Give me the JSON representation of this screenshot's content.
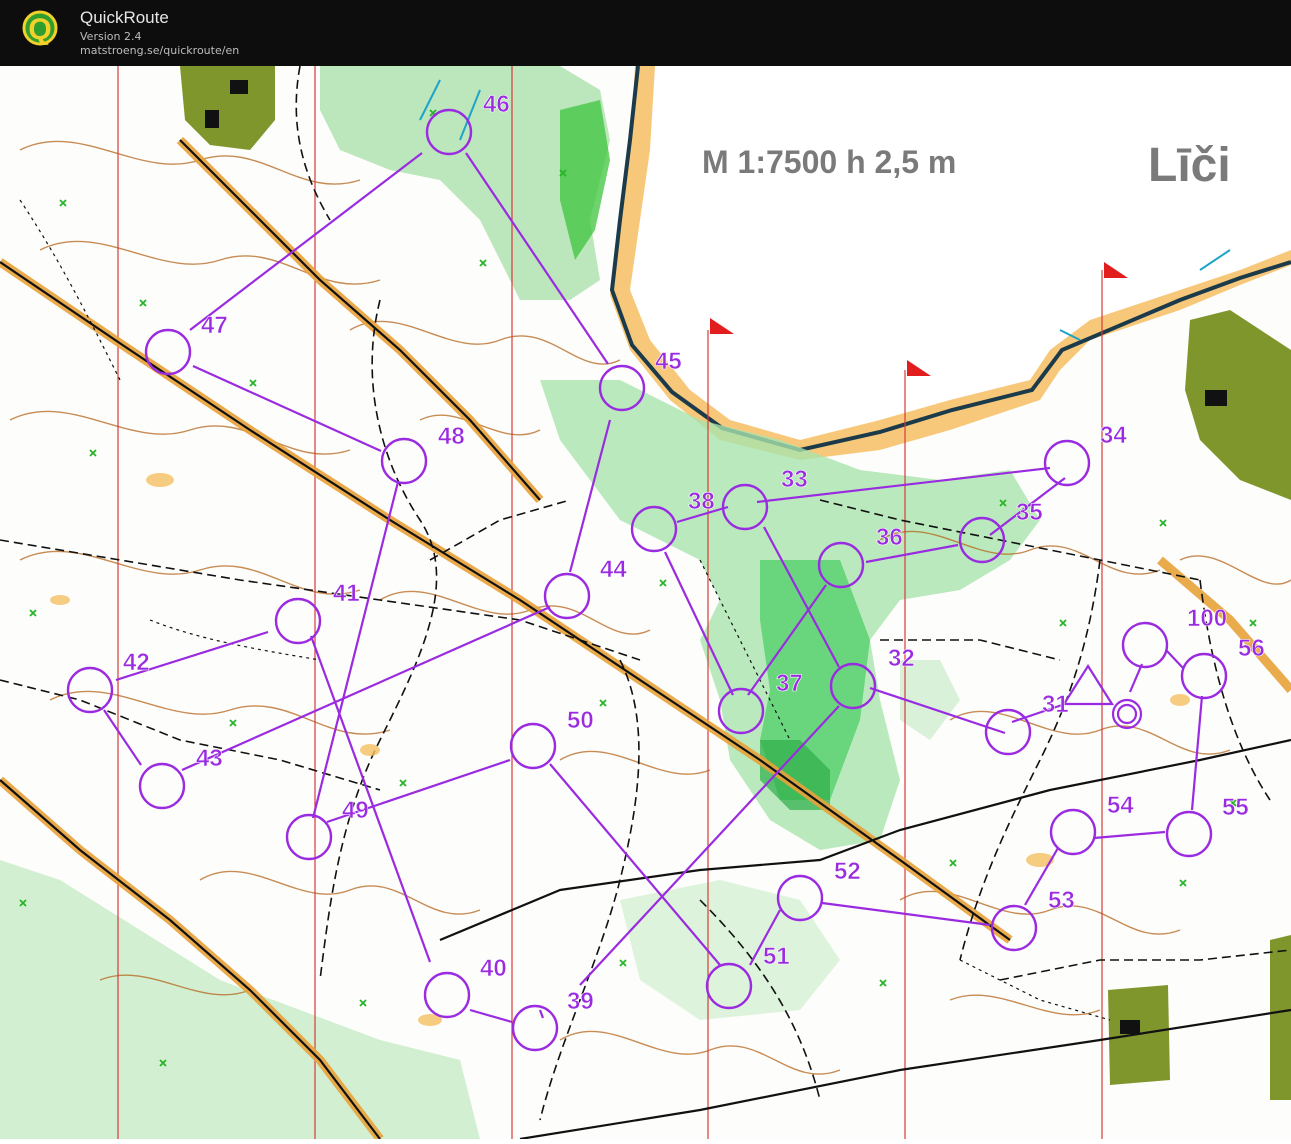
{
  "app": {
    "title": "QuickRoute",
    "version": "Version 2.4",
    "url": "matstroeng.se/quickroute/en",
    "logo_letter": "Q"
  },
  "map": {
    "scale_text": "M 1:7500 h 2,5 m",
    "area_name": "Līči",
    "course_color": "#9a2be0",
    "controls": [
      {
        "label": "31"
      },
      {
        "label": "32"
      },
      {
        "label": "33"
      },
      {
        "label": "34"
      },
      {
        "label": "35"
      },
      {
        "label": "36"
      },
      {
        "label": "37"
      },
      {
        "label": "38"
      },
      {
        "label": "39"
      },
      {
        "label": "40"
      },
      {
        "label": "41"
      },
      {
        "label": "42"
      },
      {
        "label": "43"
      },
      {
        "label": "44"
      },
      {
        "label": "45"
      },
      {
        "label": "46"
      },
      {
        "label": "47"
      },
      {
        "label": "48"
      },
      {
        "label": "49"
      },
      {
        "label": "50"
      },
      {
        "label": "51"
      },
      {
        "label": "52"
      },
      {
        "label": "53"
      },
      {
        "label": "54"
      },
      {
        "label": "55"
      },
      {
        "label": "56"
      },
      {
        "label": "100"
      }
    ]
  }
}
